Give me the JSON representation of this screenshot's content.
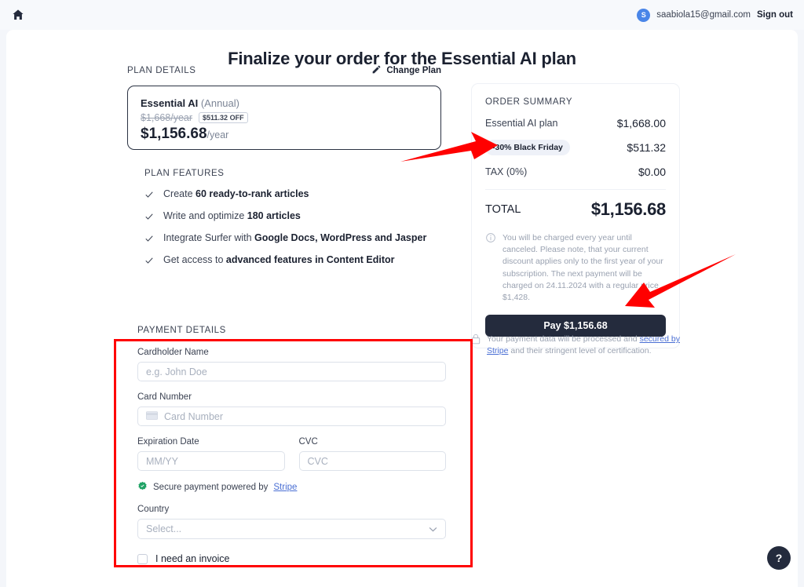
{
  "topbar": {
    "home_icon": "home-icon",
    "avatar_initial": "S",
    "email": "saabiola15@gmail.com",
    "sign_out": "Sign out"
  },
  "page_title": "Finalize your order for the Essential AI plan",
  "plan": {
    "section_label": "PLAN DETAILS",
    "change_plan": "Change Plan",
    "change_plan_icon": "pencil-icon",
    "name": "Essential AI",
    "term": "(Annual)",
    "old_price": "$1,668/year",
    "off_badge": "$511.32 OFF",
    "new_price": "$1,156.68",
    "new_price_suffix": "/year"
  },
  "features": {
    "section_label": "PLAN FEATURES",
    "check_icon": "check-icon",
    "items": [
      {
        "plain": "Create ",
        "bold": "60 ready-to-rank articles",
        "tail": ""
      },
      {
        "plain": "Write and optimize ",
        "bold": "180 articles",
        "tail": ""
      },
      {
        "plain": "Integrate Surfer with ",
        "bold": "Google Docs, WordPress and Jasper",
        "tail": ""
      },
      {
        "plain": "Get access to ",
        "bold": "advanced features in Content Editor",
        "tail": ""
      }
    ]
  },
  "payment": {
    "section_label": "PAYMENT DETAILS",
    "cardholder_label": "Cardholder Name",
    "cardholder_placeholder": "e.g. John Doe",
    "cardnumber_label": "Card Number",
    "cardnumber_placeholder": "Card Number",
    "cardnumber_icon": "credit-card-icon",
    "expiration_label": "Expiration Date",
    "expiration_placeholder": "MM/YY",
    "cvc_label": "CVC",
    "cvc_placeholder": "CVC",
    "secure_icon": "verified-badge-icon",
    "secure_text": "Secure payment powered by ",
    "secure_link": "Stripe",
    "country_label": "Country",
    "country_value": "Select...",
    "country_caret": "chevron-down-icon",
    "invoice_checkbox_label": "I need an invoice",
    "invoice_checked": false
  },
  "summary": {
    "section_label": "ORDER SUMMARY",
    "rows": [
      {
        "key": "Essential AI plan",
        "value": "$1,668.00",
        "pill": false
      },
      {
        "key": "-30% Black Friday",
        "value": "$511.32",
        "pill": true
      },
      {
        "key": "TAX (0%)",
        "value": "$0.00",
        "pill": false
      }
    ],
    "total_label": "TOTAL",
    "total_value": "$1,156.68",
    "info_icon": "info-circle-icon",
    "note_line1": "You will be charged every year until canceled.",
    "note_line2": "Please note, that your current discount applies only to the first year of your subscription.",
    "note_line3": "The next payment will be charged on 24.11.2024 with a regular price $1,428.",
    "pay_button": "Pay $1,156.68"
  },
  "secure_note": {
    "lock_icon": "lock-icon",
    "text_before": "Your payment data will be processed and ",
    "link": "secured by Stripe",
    "text_after": " and their stringent level of certification."
  },
  "help": {
    "label": "?",
    "icon": "question-mark-icon"
  },
  "annotations": {
    "highlight_color": "#ff0000",
    "arrow1_target": "black-friday-discount-pill",
    "arrow2_target": "pay-button",
    "box_target": "payment-details-form"
  }
}
